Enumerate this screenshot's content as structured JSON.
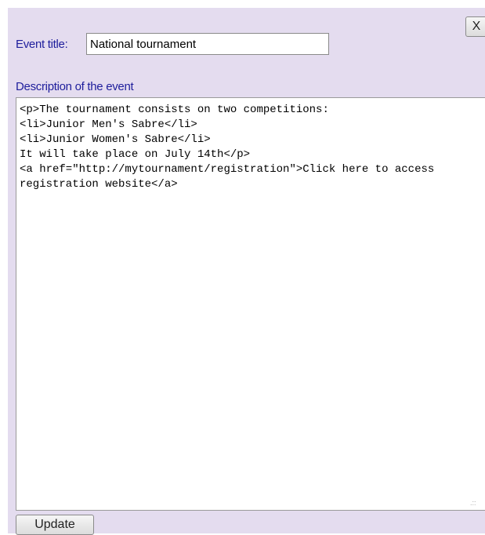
{
  "dialog": {
    "close_label": "X",
    "title_label": "Event title:",
    "title_value": "National tournament",
    "description_label": "Description of the event",
    "description_value": "<p>The tournament consists on two competitions:\n<li>Junior Men's Sabre</li>\n<li>Junior Women's Sabre</li>\nIt will take place on July 14th</p>\n<a href=\"http://mytournament/registration\">Click here to access registration website</a>",
    "update_label": "Update"
  },
  "colors": {
    "panel_background": "#e4dcef",
    "label_text": "#1e1e9c"
  }
}
